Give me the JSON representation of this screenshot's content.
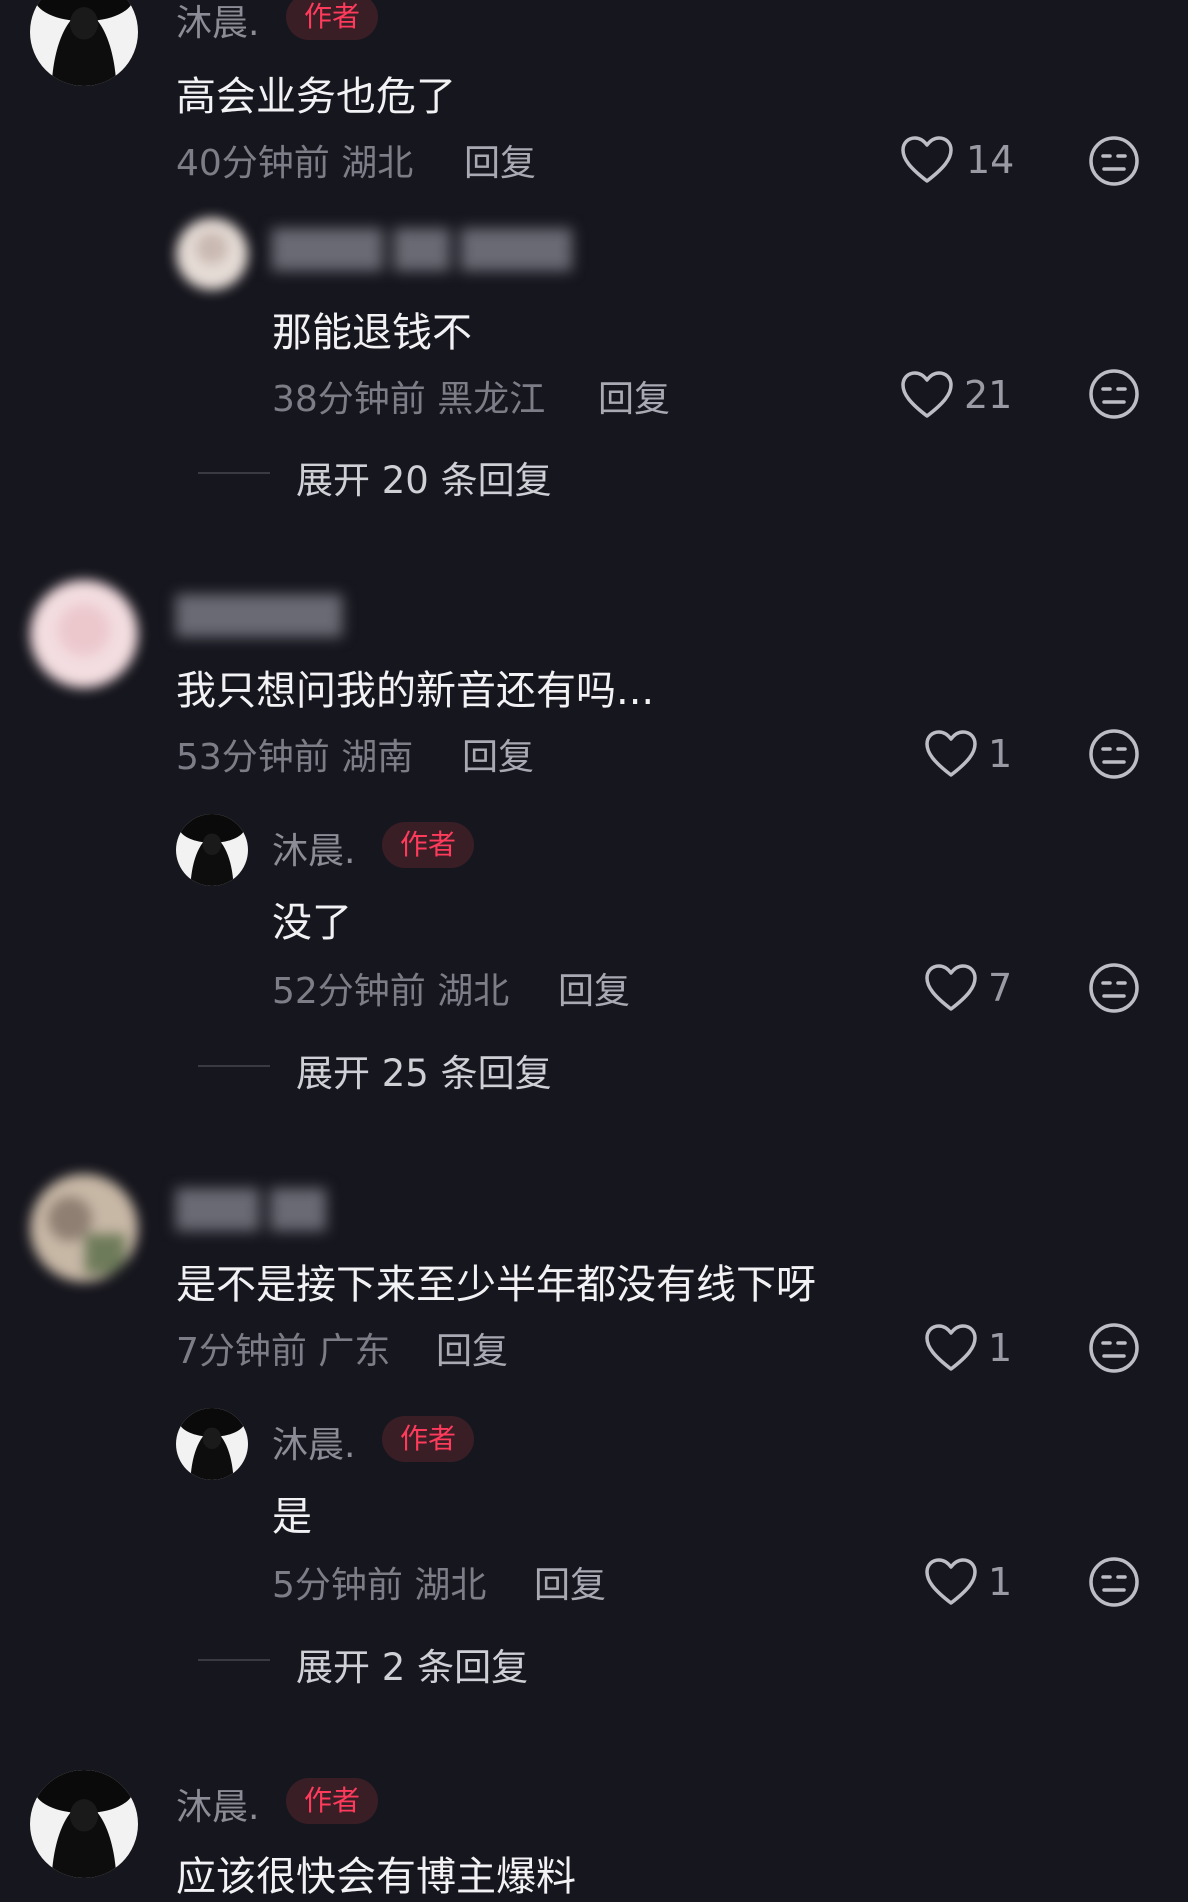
{
  "comments": [
    {
      "author": "沐晨.",
      "badge": "作者",
      "text": "高会业务也危了",
      "time": "40分钟前",
      "location": "湖北",
      "reply_label": "回复",
      "likes": "14"
    },
    {
      "text": "那能退钱不",
      "time": "38分钟前",
      "location": "黑龙江",
      "reply_label": "回复",
      "likes": "21"
    },
    {
      "text": "我只想问我的新音还有吗...",
      "time": "53分钟前",
      "location": "湖南",
      "reply_label": "回复",
      "likes": "1"
    },
    {
      "author": "沐晨.",
      "badge": "作者",
      "text": "没了",
      "time": "52分钟前",
      "location": "湖北",
      "reply_label": "回复",
      "likes": "7"
    },
    {
      "text": "是不是接下来至少半年都没有线下呀",
      "time": "7分钟前",
      "location": "广东",
      "reply_label": "回复",
      "likes": "1"
    },
    {
      "author": "沐晨.",
      "badge": "作者",
      "text": "是",
      "time": "5分钟前",
      "location": "湖北",
      "reply_label": "回复",
      "likes": "1"
    },
    {
      "author": "沐晨.",
      "badge": "作者",
      "text": "应该很快会有博主爆料"
    }
  ],
  "expand_links": [
    "展开 20 条回复",
    "展开 25 条回复",
    "展开 2 条回复"
  ],
  "colors": {
    "background": "#16161e",
    "author_badge": "#ff3b5c",
    "text": "#f2f2f5",
    "meta": "#7d7d87"
  },
  "icons": {
    "like": "heart-outline-icon",
    "dislike": "neutral-face-icon"
  }
}
